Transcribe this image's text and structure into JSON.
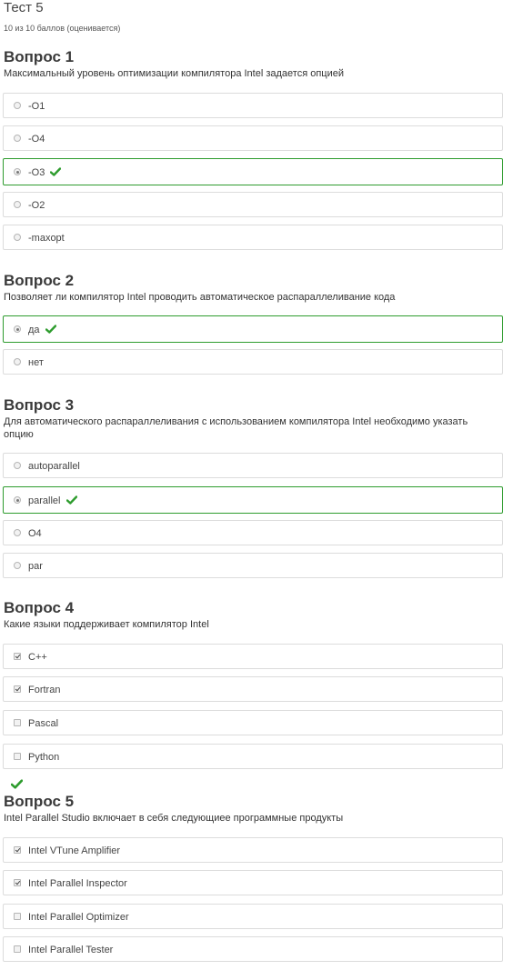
{
  "page": {
    "title": "Тест 5",
    "score": "10 из 10 баллов (оценивается)"
  },
  "colors": {
    "correct": "#2e9c2e",
    "border": "#dcdcdc"
  },
  "questions": [
    {
      "title": "Вопрос 1",
      "text": "Максимальный уровень оптимизации компилятора Intel задается опцией",
      "type": "radio",
      "options": [
        {
          "label": "-O1",
          "selected": false
        },
        {
          "label": "-O4",
          "selected": false
        },
        {
          "label": "-O3",
          "selected": true,
          "correct_mark": "check-icon"
        },
        {
          "label": "-O2",
          "selected": false
        },
        {
          "label": "-maxopt",
          "selected": false
        }
      ]
    },
    {
      "title": "Вопрос 2",
      "text": "Позволяет ли компилятор Intel проводить автоматическое распараллеливание кода",
      "type": "radio",
      "options": [
        {
          "label": "да",
          "selected": true,
          "correct_mark": "check-icon"
        },
        {
          "label": "нет",
          "selected": false
        }
      ]
    },
    {
      "title": "Вопрос 3",
      "text": "Для автоматического распараллеливания с использованием компилятора Intel необходимо указать опцию",
      "type": "radio",
      "options": [
        {
          "label": "autoparallel",
          "selected": false
        },
        {
          "label": "parallel",
          "selected": true,
          "correct_mark": "check-icon"
        },
        {
          "label": "O4",
          "selected": false
        },
        {
          "label": "par",
          "selected": false
        }
      ]
    },
    {
      "title": "Вопрос 4",
      "text": "Какие языки поддерживает компилятор Intel",
      "type": "checkbox",
      "question_mark": "check-icon",
      "options": [
        {
          "label": "C++",
          "selected": true
        },
        {
          "label": "Fortran",
          "selected": true
        },
        {
          "label": "Pascal",
          "selected": false
        },
        {
          "label": "Python",
          "selected": false
        }
      ]
    },
    {
      "title": "Вопрос 5",
      "text": "Intel Parallel Studio включает в себя следующиее программные продукты",
      "type": "checkbox",
      "options": [
        {
          "label": "Intel VTune Amplifier",
          "selected": true
        },
        {
          "label": "Intel Parallel Inspector",
          "selected": true
        },
        {
          "label": "Intel Parallel Optimizer",
          "selected": false
        },
        {
          "label": "Intel Parallel Tester",
          "selected": false
        }
      ]
    }
  ]
}
